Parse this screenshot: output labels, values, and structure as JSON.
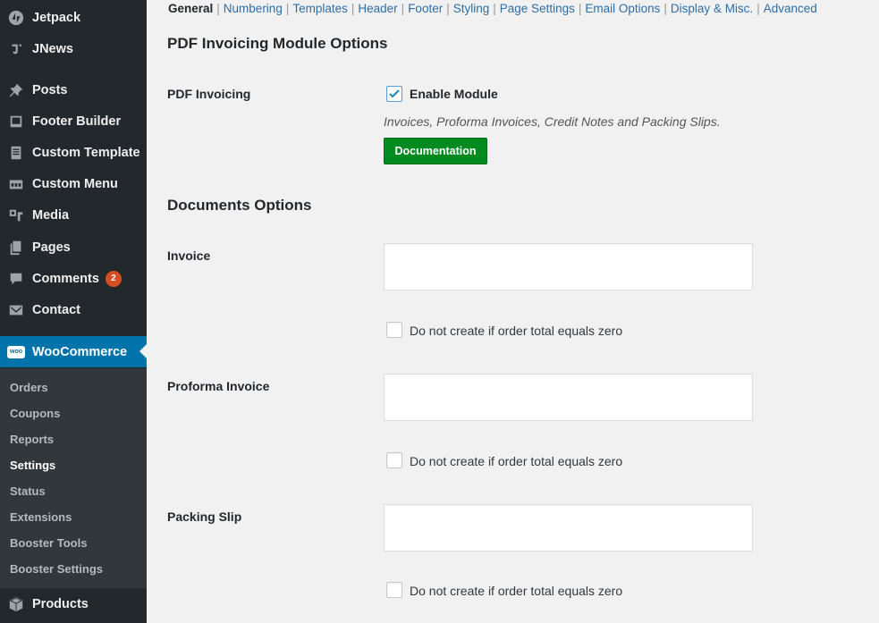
{
  "sidebar": {
    "items": [
      {
        "label": "Jetpack",
        "icon": "jetpack-icon"
      },
      {
        "label": "JNews",
        "icon": "jnews-icon"
      },
      {
        "label": "Posts",
        "icon": "pin-icon"
      },
      {
        "label": "Footer Builder",
        "icon": "footer-builder-icon"
      },
      {
        "label": "Custom Template",
        "icon": "template-icon"
      },
      {
        "label": "Custom Menu",
        "icon": "menu-icon"
      },
      {
        "label": "Media",
        "icon": "media-icon"
      },
      {
        "label": "Pages",
        "icon": "pages-icon"
      },
      {
        "label": "Comments",
        "icon": "comment-icon",
        "badge": "2"
      },
      {
        "label": "Contact",
        "icon": "envelope-icon"
      },
      {
        "label": "WooCommerce",
        "icon": "woo-icon",
        "logo_text": "woo"
      },
      {
        "label": "Products",
        "icon": "box-icon"
      }
    ],
    "submenu": [
      {
        "label": "Orders"
      },
      {
        "label": "Coupons"
      },
      {
        "label": "Reports"
      },
      {
        "label": "Settings",
        "current": true
      },
      {
        "label": "Status"
      },
      {
        "label": "Extensions"
      },
      {
        "label": "Booster Tools"
      },
      {
        "label": "Booster Settings"
      }
    ],
    "colors": {
      "background": "#23282d",
      "active": "#0073aa",
      "badge": "#d54e21"
    }
  },
  "subnav": {
    "tabs": [
      "General",
      "Numbering",
      "Templates",
      "Header",
      "Footer",
      "Styling",
      "Page Settings",
      "Email Options",
      "Display & Misc.",
      "Advanced"
    ],
    "current": "General"
  },
  "module": {
    "heading": "PDF Invoicing Module Options",
    "label": "PDF Invoicing",
    "enable_label": "Enable Module",
    "enabled": true,
    "description": "Invoices, Proforma Invoices, Credit Notes and Packing Slips.",
    "documentation_button": "Documentation",
    "button_color": "#008a20"
  },
  "documents": {
    "heading": "Documents Options",
    "items": [
      {
        "label": "Invoice",
        "value": "",
        "zero_label": "Do not create if order total equals zero",
        "zero_checked": false
      },
      {
        "label": "Proforma Invoice",
        "value": "",
        "zero_label": "Do not create if order total equals zero",
        "zero_checked": false
      },
      {
        "label": "Packing Slip",
        "value": "",
        "zero_label": "Do not create if order total equals zero",
        "zero_checked": false
      }
    ]
  }
}
